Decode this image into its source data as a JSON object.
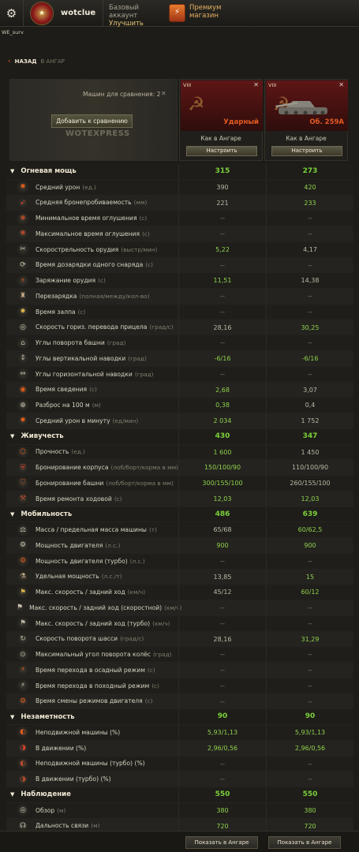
{
  "topbar": {
    "username": "wotclue",
    "account_type": "Базовый аккаунт",
    "upgrade_label": "Улучшить",
    "premium_line1": "Премиум",
    "premium_line2": "магазин"
  },
  "server": "WE_surv",
  "nav": {
    "back_label": "НАЗАД",
    "back_target": "В АНГАР"
  },
  "compare": {
    "count_label": "Машин для сравнения:",
    "count_value": "2",
    "add_button": "Добавить к сравнению",
    "watermark": "WOTEXPRESS"
  },
  "tanks": [
    {
      "tier": "VIII",
      "name": "Ударный",
      "where": "Как в Ангаре",
      "configure_label": "Настроить"
    },
    {
      "tier": "VIII",
      "name": "Об. 259А",
      "where": "Как в Ангаре",
      "configure_label": "Настроить"
    }
  ],
  "colors": {
    "good": "#8fd24a",
    "neutral": "#bdb7a3",
    "accent": "#e35a23",
    "gold": "#e6c573"
  },
  "sections": [
    {
      "title": "Огневая мощь",
      "v1": "315",
      "v2": "273",
      "stats": [
        {
          "icon": "damage-icon",
          "label": "Средний урон",
          "unit": "(ед.)",
          "v1": "390",
          "v1c": "w",
          "v2": "420",
          "v2c": "g"
        },
        {
          "icon": "penetration-icon",
          "label": "Средняя бронепробиваемость",
          "unit": "(мм)",
          "v1": "221",
          "v1c": "w",
          "v2": "233",
          "v2c": "g"
        },
        {
          "icon": "stun-min-icon",
          "label": "Минимальное время оглушения",
          "unit": "(с)",
          "v1": "--",
          "v1c": "d",
          "v2": "--",
          "v2c": "d"
        },
        {
          "icon": "stun-max-icon",
          "label": "Максимальное время оглушения",
          "unit": "(с)",
          "v1": "--",
          "v1c": "d",
          "v2": "--",
          "v2c": "d"
        },
        {
          "icon": "rate-of-fire-icon",
          "label": "Скорострельность орудия",
          "unit": "(выстр/мин)",
          "v1": "5,22",
          "v1c": "g",
          "v2": "4,17",
          "v2c": "w"
        },
        {
          "icon": "autoreload-icon",
          "label": "Время дозарядки одного снаряда",
          "unit": "(с)",
          "v1": "--",
          "v1c": "d",
          "v2": "--",
          "v2c": "d"
        },
        {
          "icon": "reload-icon",
          "label": "Заряжание орудия",
          "unit": "(с)",
          "v1": "11,51",
          "v1c": "g",
          "v2": "14,38",
          "v2c": "w"
        },
        {
          "icon": "clip-reload-icon",
          "label": "Перезарядка",
          "unit": "(полная/между/кол-во)",
          "v1": "--",
          "v1c": "d",
          "v2": "--",
          "v2c": "d"
        },
        {
          "icon": "salvo-icon",
          "label": "Время залпа",
          "unit": "(с)",
          "v1": "--",
          "v1c": "d",
          "v2": "--",
          "v2c": "d"
        },
        {
          "icon": "aim-traverse-icon",
          "label": "Скорость гориз. перевода прицела",
          "unit": "(град/с)",
          "v1": "28,16",
          "v1c": "w",
          "v2": "30,25",
          "v2c": "g"
        },
        {
          "icon": "turret-angle-icon",
          "label": "Углы поворота башни",
          "unit": "(град)",
          "v1": "--",
          "v1c": "d",
          "v2": "--",
          "v2c": "d"
        },
        {
          "icon": "vertical-aim-icon",
          "label": "Углы вертикальной наводки",
          "unit": "(град)",
          "v1": "-6/16",
          "v1c": "g",
          "v2": "-6/16",
          "v2c": "g"
        },
        {
          "icon": "horizontal-aim-icon",
          "label": "Углы горизонтальной наводки",
          "unit": "(град)",
          "v1": "--",
          "v1c": "d",
          "v2": "--",
          "v2c": "d"
        },
        {
          "icon": "aim-time-icon",
          "label": "Время сведения",
          "unit": "(с)",
          "v1": "2,68",
          "v1c": "g",
          "v2": "3,07",
          "v2c": "w"
        },
        {
          "icon": "dispersion-icon",
          "label": "Разброс на 100 м",
          "unit": "(м)",
          "v1": "0,38",
          "v1c": "g",
          "v2": "0,4",
          "v2c": "w"
        },
        {
          "icon": "dpm-icon",
          "label": "Средний урон в минуту",
          "unit": "(ед/мин)",
          "v1": "2 034",
          "v1c": "g",
          "v2": "1 752",
          "v2c": "w"
        }
      ]
    },
    {
      "title": "Живучесть",
      "v1": "430",
      "v2": "347",
      "stats": [
        {
          "icon": "hitpoints-icon",
          "label": "Прочность",
          "unit": "(ед.)",
          "v1": "1 600",
          "v1c": "g",
          "v2": "1 450",
          "v2c": "w"
        },
        {
          "icon": "hull-armor-icon",
          "label": "Бронирование корпуса",
          "unit": "(лоб/борт/корма в мм)",
          "v1": "150/100/90",
          "v1c": "g",
          "v2": "110/100/90",
          "v2c": "w"
        },
        {
          "icon": "turret-armor-icon",
          "label": "Бронирование башни",
          "unit": "(лоб/борт/корма в мм)",
          "v1": "300/155/100",
          "v1c": "g",
          "v2": "260/155/100",
          "v2c": "w"
        },
        {
          "icon": "repair-icon",
          "label": "Время ремонта ходовой",
          "unit": "(с)",
          "v1": "12,03",
          "v1c": "g",
          "v2": "12,03",
          "v2c": "g"
        }
      ]
    },
    {
      "title": "Мобильность",
      "v1": "486",
      "v2": "639",
      "stats": [
        {
          "icon": "weight-icon",
          "label": "Масса / предельная масса машины",
          "unit": "(т)",
          "v1": "65/68",
          "v1c": "w",
          "v2": "60/62,5",
          "v2c": "g"
        },
        {
          "icon": "engine-power-icon",
          "label": "Мощность двигателя",
          "unit": "(л.с.)",
          "v1": "900",
          "v1c": "g",
          "v2": "900",
          "v2c": "g"
        },
        {
          "icon": "engine-turbo-icon",
          "label": "Мощность двигателя (турбо)",
          "unit": "(л.с.)",
          "v1": "--",
          "v1c": "d",
          "v2": "--",
          "v2c": "d"
        },
        {
          "icon": "specific-power-icon",
          "label": "Удельная мощность",
          "unit": "(л.с./т)",
          "v1": "13,85",
          "v1c": "w",
          "v2": "15",
          "v2c": "g"
        },
        {
          "icon": "speed-icon",
          "label": "Макс. скорость / задний ход",
          "unit": "(км/ч)",
          "v1": "45/12",
          "v1c": "w",
          "v2": "60/12",
          "v2c": "g"
        },
        {
          "icon": "speed-fast-icon",
          "label": "Макс. скорость / задний ход (скоростной)",
          "unit": "(км/ч)",
          "v1": "--",
          "v1c": "d",
          "v2": "--",
          "v2c": "d"
        },
        {
          "icon": "speed-turbo-icon",
          "label": "Макс. скорость / задний ход (турбо)",
          "unit": "(км/ч)",
          "v1": "--",
          "v1c": "d",
          "v2": "--",
          "v2c": "d"
        },
        {
          "icon": "traverse-icon",
          "label": "Скорость поворота шасси",
          "unit": "(град/с)",
          "v1": "28,16",
          "v1c": "w",
          "v2": "31,29",
          "v2c": "g"
        },
        {
          "icon": "wheel-angle-icon",
          "label": "Максимальный угол поворота колёс",
          "unit": "(град)",
          "v1": "--",
          "v1c": "d",
          "v2": "--",
          "v2c": "d"
        },
        {
          "icon": "siege-mode-icon",
          "label": "Время перехода в осадный режим",
          "unit": "(с)",
          "v1": "--",
          "v1c": "d",
          "v2": "--",
          "v2c": "d"
        },
        {
          "icon": "travel-mode-icon",
          "label": "Время перехода в походный режим",
          "unit": "(с)",
          "v1": "--",
          "v1c": "d",
          "v2": "--",
          "v2c": "d"
        },
        {
          "icon": "engine-mode-icon",
          "label": "Время смены режимов двигателя",
          "unit": "(с)",
          "v1": "--",
          "v1c": "d",
          "v2": "--",
          "v2c": "d"
        }
      ]
    },
    {
      "title": "Незаметность",
      "v1": "90",
      "v2": "90",
      "stats": [
        {
          "icon": "camo-still-icon",
          "label": "Неподвижной машины (%)",
          "unit": "",
          "v1": "5,93/1,13",
          "v1c": "g",
          "v2": "5,93/1,13",
          "v2c": "g"
        },
        {
          "icon": "camo-moving-icon",
          "label": "В движении (%)",
          "unit": "",
          "v1": "2,96/0,56",
          "v1c": "g",
          "v2": "2,96/0,56",
          "v2c": "g"
        },
        {
          "icon": "camo-still-turbo-icon",
          "label": "Неподвижной машины (турбо) (%)",
          "unit": "",
          "v1": "--",
          "v1c": "d",
          "v2": "--",
          "v2c": "d"
        },
        {
          "icon": "camo-moving-turbo-icon",
          "label": "В движении (турбо) (%)",
          "unit": "",
          "v1": "--",
          "v1c": "d",
          "v2": "--",
          "v2c": "d"
        }
      ]
    },
    {
      "title": "Наблюдение",
      "v1": "550",
      "v2": "550",
      "stats": [
        {
          "icon": "view-range-icon",
          "label": "Обзор",
          "unit": "(м)",
          "v1": "380",
          "v1c": "g",
          "v2": "380",
          "v2c": "g"
        },
        {
          "icon": "radio-range-icon",
          "label": "Дальность связи",
          "unit": "(м)",
          "v1": "720",
          "v1c": "g",
          "v2": "720",
          "v2c": "g"
        }
      ]
    }
  ],
  "bottom": {
    "show_hangar_1": "Показать в Ангаре",
    "show_hangar_2": "Показать в Ангаре"
  }
}
